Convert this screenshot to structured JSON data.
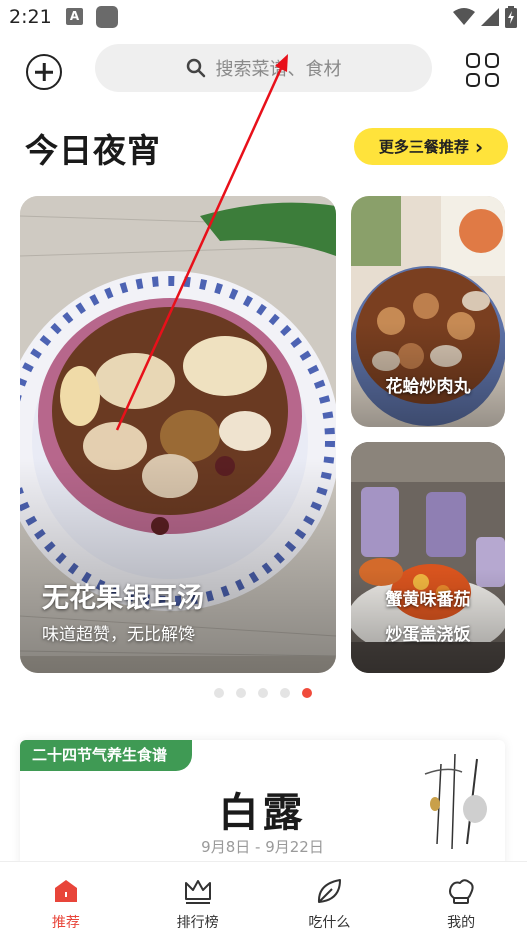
{
  "status_bar": {
    "time": "2:21",
    "notification_letter": "A"
  },
  "search": {
    "placeholder": "搜索菜谱、食材"
  },
  "section": {
    "title": "今日夜宵",
    "more_label": "更多三餐推荐",
    "more_arrow": "›"
  },
  "cards": [
    {
      "title": "无花果银耳汤",
      "subtitle": "味道超赞，无比解馋"
    },
    {
      "title": "花蛤炒肉丸"
    },
    {
      "title_line1": "蟹黄味番茄",
      "title_line2": "炒蛋盖浇饭"
    }
  ],
  "pager": {
    "count": 5,
    "active_index": 4
  },
  "solar_term": {
    "tag": "二十四节气养生食谱",
    "name": "白露",
    "dates": "9月8日 - 9月22日"
  },
  "bottom_nav": [
    {
      "label": "推荐",
      "icon": "recommend-icon",
      "active": true
    },
    {
      "label": "排行榜",
      "icon": "crown-icon",
      "active": false
    },
    {
      "label": "吃什么",
      "icon": "leaf-icon",
      "active": false
    },
    {
      "label": "我的",
      "icon": "chef-hat-icon",
      "active": false
    }
  ],
  "colors": {
    "accent": "#f04b3b",
    "more_button": "#ffe33b",
    "term_tag": "#3f9a54",
    "annotation_arrow": "#e8101a"
  }
}
